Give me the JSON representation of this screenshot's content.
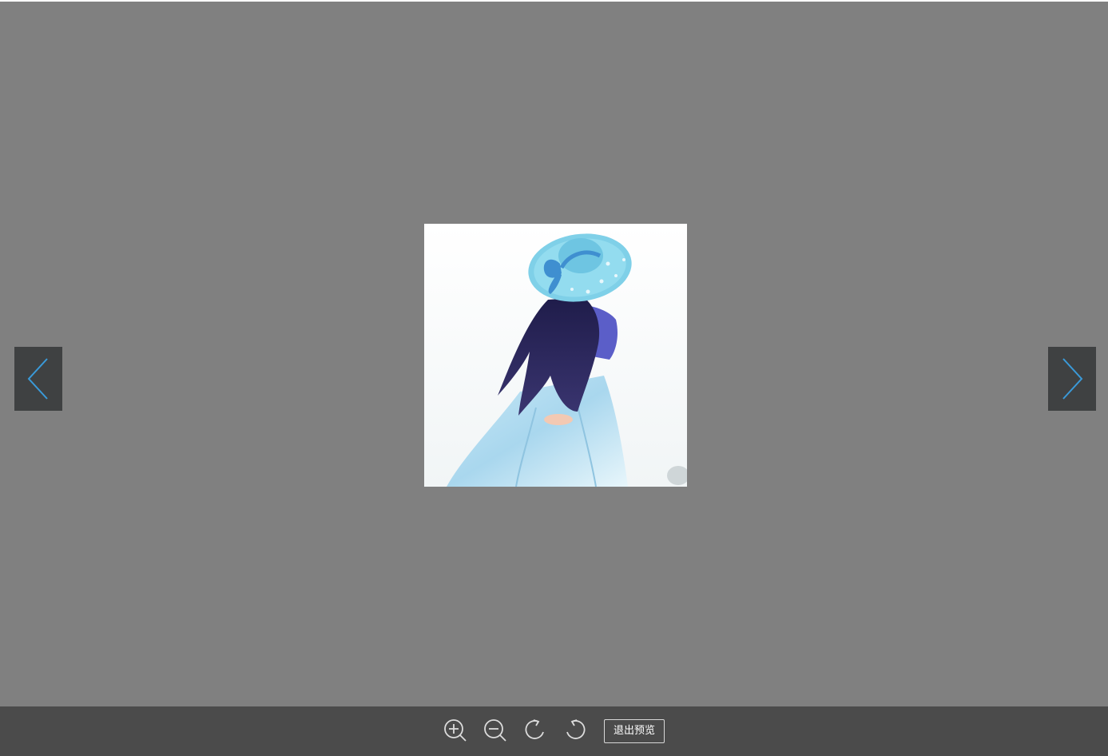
{
  "viewer": {
    "background_color": "#808080",
    "image": {
      "subject": "girl-in-blue-sun-hat-illustration"
    },
    "nav": {
      "prev_icon": "chevron-left-icon",
      "next_icon": "chevron-right-icon",
      "arrow_color": "#3a9ad9",
      "button_color": "#3f4142"
    }
  },
  "toolbar": {
    "background_color": "#4b4b4b",
    "buttons": [
      {
        "icon": "zoom-in-icon"
      },
      {
        "icon": "zoom-out-icon"
      },
      {
        "icon": "rotate-clockwise-icon"
      },
      {
        "icon": "rotate-counterclockwise-icon"
      }
    ],
    "exit_label": "退出预览"
  }
}
